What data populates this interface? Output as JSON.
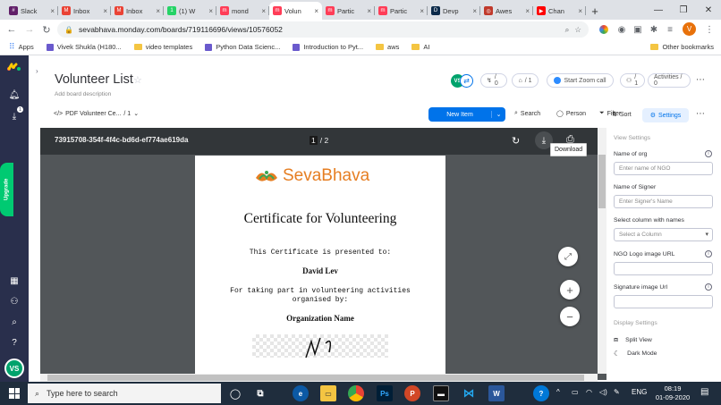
{
  "browser": {
    "tabs": [
      {
        "label": "Slack",
        "icon_color": "#611f69",
        "glyph": "#"
      },
      {
        "label": "Inbox",
        "icon_color": "#ea4335",
        "glyph": "M"
      },
      {
        "label": "Inbox",
        "icon_color": "#ea4335",
        "glyph": "M"
      },
      {
        "label": "(1) W",
        "icon_color": "#25d366",
        "glyph": "1"
      },
      {
        "label": "mond",
        "icon_color": "#ff3d57",
        "glyph": "m"
      },
      {
        "label": "Volun",
        "icon_color": "#ff3d57",
        "glyph": "m",
        "active": true
      },
      {
        "label": "Partic",
        "icon_color": "#ff3d57",
        "glyph": "m"
      },
      {
        "label": "Partic",
        "icon_color": "#ff3d57",
        "glyph": "m"
      },
      {
        "label": "Devp",
        "icon_color": "#0b2a4a",
        "glyph": "D"
      },
      {
        "label": "Awes",
        "icon_color": "#c0392b",
        "glyph": "◎"
      },
      {
        "label": "Chan",
        "icon_color": "#ff0000",
        "glyph": "▶"
      }
    ],
    "close_glyph": "×",
    "newtab_glyph": "+",
    "url": "sevabhava.monday.com/boards/719116696/views/10576052",
    "profile_initial": "V",
    "bookmarks": [
      {
        "label": "Apps",
        "type": "apps"
      },
      {
        "label": "Vivek Shukla (H180...",
        "type": "site"
      },
      {
        "label": "video templates",
        "type": "folder"
      },
      {
        "label": "Python Data Scienc...",
        "type": "site"
      },
      {
        "label": "Introduction to Pyt...",
        "type": "site"
      },
      {
        "label": "aws",
        "type": "folder"
      },
      {
        "label": "AI",
        "type": "folder"
      }
    ],
    "other_bookmarks": "Other bookmarks"
  },
  "rail": {
    "upgrade_label": "Upgrade",
    "inbox_badge": "1",
    "avatar_initials": "VS"
  },
  "board": {
    "title": "Volunteer List",
    "description": "Add board description",
    "activity_count": "/ 0",
    "updates_count": "/ 1",
    "zoom_label": "Start Zoom call",
    "members_count": "/ 1",
    "activities_label": "Activities / 0",
    "header_avatar": "VS",
    "view_name": "PDF Volunteer Ce...",
    "view_count": "/ 1",
    "new_item": "New Item",
    "search": "Search",
    "person": "Person",
    "filter": "Filter",
    "sort": "Sort",
    "settings": "Settings"
  },
  "pdf": {
    "filename": "73915708-354f-4f4c-bd6d-ef774ae619da",
    "page_current": "1",
    "page_total": "/ 2",
    "tooltip": "Download",
    "logo_text": "SevaBhava",
    "cert_title": "Certificate for Volunteering",
    "presented": "This Certificate is presented to:",
    "name": "David Lev",
    "taking_part_1": "For taking part in volunteering activities",
    "taking_part_2": "organised by:",
    "org": "Organization Name"
  },
  "panel": {
    "view_settings": "View Settings",
    "org_label": "Name of org",
    "org_placeholder": "Enter name of NGO",
    "signer_label": "Name of Signer",
    "signer_placeholder": "Enter Signer's Name",
    "column_label": "Select column with names",
    "column_placeholder": "Select a Column",
    "logo_label": "NGO Logo image URL",
    "sig_label": "Signature image Url",
    "display_settings": "Display Settings",
    "split_view": "Split View",
    "dark_mode": "Dark Mode"
  },
  "taskbar": {
    "search_placeholder": "Type here to search",
    "lang": "ENG",
    "time": "08:19",
    "date": "01-09-2020"
  },
  "colors": {
    "monday_rail": "#292f4c",
    "monday_blue": "#0073ea",
    "upgrade_green": "#00ca72",
    "pdf_bg": "#525659",
    "pdf_bar": "#323639",
    "seva_orange": "#e67e22",
    "seva_green": "#3aa655"
  }
}
